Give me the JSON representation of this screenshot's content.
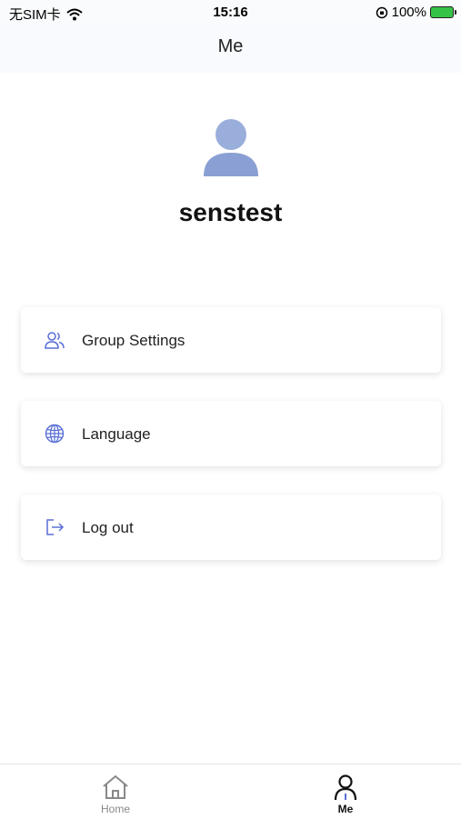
{
  "status_bar": {
    "carrier": "无SIM卡",
    "time": "15:16",
    "battery": "100%"
  },
  "header": {
    "title": "Me"
  },
  "profile": {
    "username": "senstest"
  },
  "menu": {
    "items": [
      {
        "label": "Group Settings",
        "icon": "group-icon"
      },
      {
        "label": "Language",
        "icon": "globe-icon"
      },
      {
        "label": "Log out",
        "icon": "logout-icon"
      }
    ]
  },
  "tab_bar": {
    "tabs": [
      {
        "label": "Home",
        "active": false
      },
      {
        "label": "Me",
        "active": true
      }
    ]
  },
  "colors": {
    "accent": "#5a6fd6",
    "avatar": "#94a6d6",
    "active_tab": "#111111",
    "inactive_tab": "#888888"
  }
}
